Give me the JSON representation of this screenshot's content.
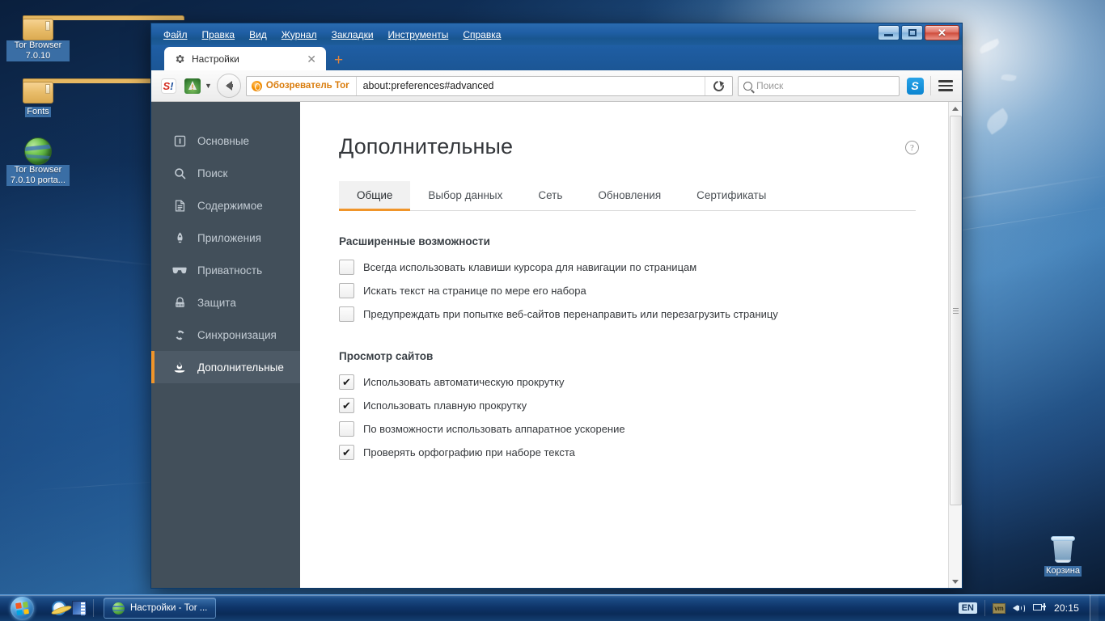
{
  "desktop": {
    "icons": [
      {
        "name": "tor-browser-folder",
        "label": "Tor Browser 7.0.10",
        "type": "folder"
      },
      {
        "name": "fonts-folder",
        "label": "Fonts",
        "type": "folder"
      },
      {
        "name": "tor-browser-portable",
        "label": "Tor Browser 7.0.10 porta...",
        "type": "globe"
      }
    ],
    "recycle_bin_label": "Корзина"
  },
  "taskbar": {
    "start_tooltip": "Пуск",
    "quick_launch": [
      "internet-explorer-icon",
      "visualizer-icon"
    ],
    "tasks": [
      {
        "label": "Настройки - Tor ...",
        "icon": "tor-globe-icon",
        "active": true
      }
    ],
    "tray": {
      "language": "EN",
      "icons": [
        "vm-icon",
        "volume-icon",
        "network-icon"
      ],
      "clock": "20:15"
    }
  },
  "window": {
    "menubar": [
      {
        "label": "Файл",
        "accel": "Ф"
      },
      {
        "label": "Правка",
        "accel": "П"
      },
      {
        "label": "Вид",
        "accel": "В"
      },
      {
        "label": "Журнал",
        "accel": "Ж"
      },
      {
        "label": "Закладки",
        "accel": "З"
      },
      {
        "label": "Инструменты",
        "accel": "И"
      },
      {
        "label": "Справка",
        "accel": "С"
      }
    ],
    "controls": {
      "minimize": "—",
      "maximize": "□",
      "close": "✕"
    },
    "tabs": [
      {
        "title": "Настройки",
        "icon": "gear-icon",
        "active": true
      }
    ],
    "new_tab_label": "+",
    "toolbar": {
      "back_tooltip": "Назад",
      "identity_label": "Обозреватель Tor",
      "url_value": "about:preferences#advanced",
      "reload_tooltip": "Перезагрузить текущую страницу",
      "search_placeholder": "Поиск",
      "search_value": "",
      "addons": [
        "s-bang-icon",
        "noscript-icon",
        "skype-icon"
      ],
      "menu_tooltip": "Открыть меню"
    }
  },
  "sidebar": {
    "items": [
      {
        "label": "Основные",
        "icon": "general-icon",
        "active": false
      },
      {
        "label": "Поиск",
        "icon": "search-icon",
        "active": false
      },
      {
        "label": "Содержимое",
        "icon": "content-icon",
        "active": false
      },
      {
        "label": "Приложения",
        "icon": "apps-icon",
        "active": false
      },
      {
        "label": "Приватность",
        "icon": "privacy-icon",
        "active": false
      },
      {
        "label": "Защита",
        "icon": "security-icon",
        "active": false
      },
      {
        "label": "Синхронизация",
        "icon": "sync-icon",
        "active": false
      },
      {
        "label": "Дополнительные",
        "icon": "advanced-icon",
        "active": true
      }
    ]
  },
  "main": {
    "title": "Дополнительные",
    "help_label": "?",
    "tabs": [
      {
        "label": "Общие",
        "active": true
      },
      {
        "label": "Выбор данных",
        "active": false
      },
      {
        "label": "Сеть",
        "active": false
      },
      {
        "label": "Обновления",
        "active": false
      },
      {
        "label": "Сертификаты",
        "active": false
      }
    ],
    "sections": [
      {
        "title": "Расширенные возможности",
        "options": [
          {
            "label": "Всегда использовать клавиши курсора для навигации по страницам",
            "accel": "к",
            "checked": false
          },
          {
            "label": "Искать текст на странице по мере его набора",
            "accel": "а",
            "checked": false
          },
          {
            "label": "Предупреждать при попытке веб-сайтов перенаправить или перезагрузить страницу",
            "accel": "р",
            "checked": false
          }
        ]
      },
      {
        "title": "Просмотр сайтов",
        "options": [
          {
            "label": "Использовать автоматическую прокрутку",
            "accel": "с",
            "checked": true
          },
          {
            "label": "Использовать плавную прокрутку",
            "accel": "о",
            "checked": true
          },
          {
            "label": "По возможности использовать аппаратное ускорение",
            "accel": "л",
            "checked": false
          },
          {
            "label": "Проверять орфографию при наборе текста",
            "accel": "в",
            "checked": true
          }
        ]
      }
    ]
  },
  "colors": {
    "accent_orange": "#f0952a",
    "sidebar_bg": "#424f5a",
    "sidebar_active_bg": "#4d5a66",
    "titlebar_blue": "#1f5ea4",
    "identity_orange": "#d97b0a"
  }
}
